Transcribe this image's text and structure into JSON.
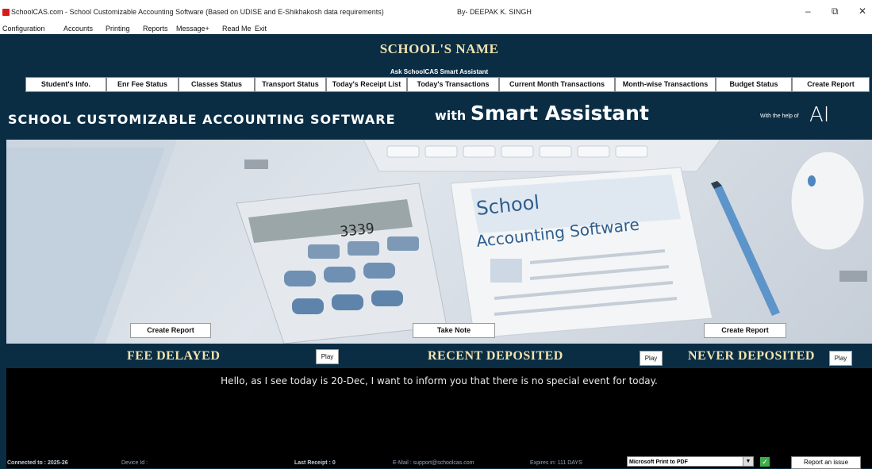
{
  "window": {
    "title": "SchoolCAS.com - School Customizable Accounting Software (Based on UDISE and E-Shikhakosh data requirements)",
    "author": "By- DEEPAK K. SINGH",
    "minimize_label": "–",
    "restore_label": "⧉",
    "close_label": "✕"
  },
  "menu": [
    "Configuration",
    "Accounts",
    "Printing",
    "Reports",
    "Message+",
    "Read Me",
    "Exit"
  ],
  "header": {
    "school_name": "SCHOOL'S NAME",
    "assistant_label": "Ask SchoolCAS Smart Assistant"
  },
  "tabs": [
    "Student's Info.",
    "Enr Fee Status",
    "Classes Status",
    "Transport Status",
    "Today's Receipt List",
    "Today's Transactions",
    "Current Month Transactions",
    "Month-wise Transactions",
    "Budget Status",
    "Create Report"
  ],
  "hero": {
    "left_text": "SCHOOL CUSTOMIZABLE ACCOUNTING SOFTWARE",
    "with_text": "with",
    "smart_text": "Smart Assistant",
    "help_text": "With the help of",
    "ai_logo": "AI"
  },
  "photo": {
    "calc_display": "3339",
    "paper_title": "School",
    "paper_subtitle": "Accounting Software",
    "buttons": [
      "Create Report",
      "Take Note",
      "Create Report"
    ]
  },
  "strip": {
    "fee_delayed": "FEE DELAYED",
    "recent_deposited": "RECENT DEPOSITED",
    "never_deposited": "NEVER DEPOSITED",
    "play_label": "Play"
  },
  "message": "Hello, as I see today is 20-Dec, I want to inform you that there is no special event for today.",
  "status": {
    "connected": "Connected to :  2025-26",
    "device": "Device Id :",
    "last_receipt": "Last Receipt :  0",
    "email": "E-Mail : support@schoolcas.com",
    "expires": "Expires in:  111 DAYS",
    "printer": "Microsoft Print to PDF",
    "report_issue": "Report an issue"
  }
}
